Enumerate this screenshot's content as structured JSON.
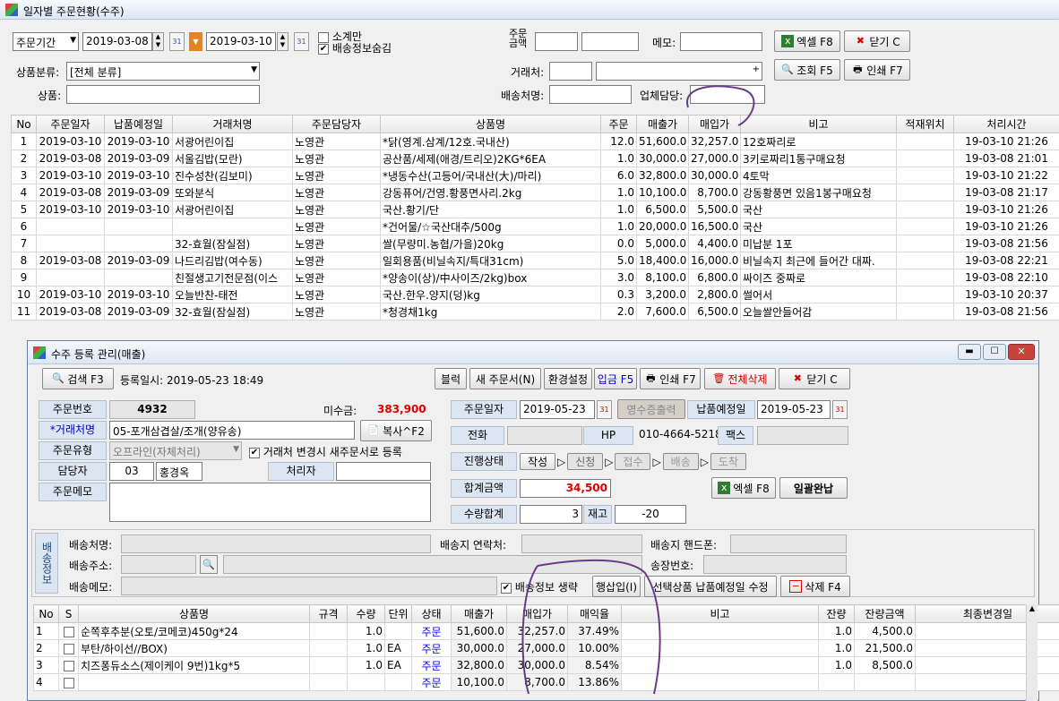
{
  "main": {
    "title": "일자별 주문현황(수주)",
    "period_select": "주문기간",
    "date_from": "2019-03-08",
    "date_to": "2019-03-10",
    "chk_subtotal": "소계만",
    "chk_hide_delivery": "배송정보숨김",
    "order_amount_label": "주문\n금액",
    "memo_label": "메모:",
    "excel_btn": "엑셀 F8",
    "close_btn": "닫기 C",
    "category_label": "상품분류:",
    "category_value": "[전체 분류]",
    "client_label": "거래처:",
    "search_btn": "조회 F5",
    "print_btn": "인쇄 F7",
    "product_label": "상품:",
    "recipient_label": "배송처명:",
    "manager_label": "업체담당:",
    "columns": [
      "No",
      "주문일자",
      "납품예정일",
      "거래처명",
      "주문담당자",
      "상품명",
      "주문",
      "매출가",
      "매입가",
      "비고",
      "적재위치",
      "처리시간"
    ],
    "rows": [
      [
        "1",
        "2019-03-10",
        "2019-03-10",
        "서광어린이집",
        "노영관",
        "*닭(영계.삼계/12호.국내산)",
        "12.0",
        "51,600.0",
        "32,257.0",
        "12호짜리로",
        "",
        "19-03-10 21:26"
      ],
      [
        "2",
        "2019-03-08",
        "2019-03-09",
        "서울김밥(모란)",
        "노영관",
        "공산품/세제(애경/트리오)2KG*6EA",
        "1.0",
        "30,000.0",
        "27,000.0",
        "3키로짜리1통구매요청",
        "",
        "19-03-08 21:01"
      ],
      [
        "3",
        "2019-03-10",
        "2019-03-10",
        "진수성찬(김보미)",
        "노영관",
        "*냉동수산(고등어/국내산(大)/마리)",
        "6.0",
        "32,800.0",
        "30,000.0",
        "4토막",
        "",
        "19-03-10 21:22"
      ],
      [
        "4",
        "2019-03-08",
        "2019-03-09",
        "또와분식",
        "노영관",
        "강동퓨어/건영.황풍면사리.2kg",
        "1.0",
        "10,100.0",
        "8,700.0",
        "강동황풍면 있음1봉구매요청",
        "",
        "19-03-08 21:17"
      ],
      [
        "5",
        "2019-03-10",
        "2019-03-10",
        "서광어린이집",
        "노영관",
        "국산.황기/단",
        "1.0",
        "6,500.0",
        "5,500.0",
        "국산",
        "",
        "19-03-10 21:26"
      ],
      [
        "6",
        "",
        "",
        "",
        "노영관",
        "*건어물/☆국산대추/500g",
        "1.0",
        "20,000.0",
        "16,500.0",
        "국산",
        "",
        "19-03-10 21:26"
      ],
      [
        "7",
        "",
        "",
        "32-효월(잠실점)",
        "노영관",
        "쌀(무량미.농협/가을)20kg",
        "0.0",
        "5,000.0",
        "4,400.0",
        "미납분 1포",
        "",
        "19-03-08 21:56"
      ],
      [
        "8",
        "2019-03-08",
        "2019-03-09",
        "나드리김밥(여수동)",
        "노영관",
        "일회용품(비닐속지/특대31cm)",
        "5.0",
        "18,400.0",
        "16,000.0",
        "비닐속지 최근에 들어간 대짜.",
        "",
        "19-03-08 22:21"
      ],
      [
        "9",
        "",
        "",
        "친절생고기전문점(이스",
        "노영관",
        "*양송이(상)/中사이즈/2kg)box",
        "3.0",
        "8,100.0",
        "6,800.0",
        "싸이즈 중짜로",
        "",
        "19-03-08 22:10"
      ],
      [
        "10",
        "2019-03-10",
        "2019-03-10",
        "오늘반찬-태전",
        "노영관",
        "국산.한우.양지(덩)kg",
        "0.3",
        "3,200.0",
        "2,800.0",
        "썰어서",
        "",
        "19-03-10 20:37"
      ],
      [
        "11",
        "2019-03-08",
        "2019-03-09",
        "32-효월(잠실점)",
        "노영관",
        "*청경채1kg",
        "2.0",
        "7,600.0",
        "6,500.0",
        "오늘쌀안들어감",
        "",
        "19-03-08 21:56"
      ]
    ]
  },
  "dialog": {
    "title": "수주 등록 관리(매출)",
    "search_btn": "검색 F3",
    "reg_date": "등록일시: 2019-05-23 18:49",
    "toolbar": [
      "블럭",
      "새 주문서(N)",
      "환경설정",
      "입금 F5",
      "인쇄 F7",
      "전체삭제",
      "닫기 C"
    ],
    "order_no_label": "주문번호",
    "order_no": "4932",
    "unpaid_label": "미수금:",
    "unpaid": "383,900",
    "client_label": "*거래처명",
    "client": "05-포개삼겹살/조개(양유송)",
    "copy_btn": "복사^F2",
    "order_type_label": "주문유형",
    "order_type": "오프라인(자체처리)",
    "chk_new_order": "거래처 변경시 새주문서로 등록",
    "staff_label": "담당자",
    "staff_code": "03",
    "staff_name": "홍경옥",
    "handler_label": "처리자",
    "memo_label": "주문메모",
    "order_date_label": "주문일자",
    "order_date": "2019-05-23",
    "receipt_btn": "영수증출력",
    "delivery_date_label": "납품예정일",
    "delivery_date": "2019-05-23",
    "phone_label": "전화",
    "hp_label": "HP",
    "hp": "010-4664-5218",
    "fax_label": "팩스",
    "progress_label": "진행상태",
    "steps": [
      "작성",
      "신청",
      "접수",
      "배송",
      "도착"
    ],
    "total_label": "합계금액",
    "total": "34,500",
    "excel_btn": "엑셀 F8",
    "payall_btn": "일괄완납",
    "qty_label": "수량합계",
    "qty": "3",
    "stock_label": "재고",
    "stock": "-20",
    "ship_side": "배송정보",
    "ship_name_label": "배송처명:",
    "ship_contact_label": "배송지 연락처:",
    "ship_phone_label": "배송지 핸드폰:",
    "ship_addr_label": "배송주소:",
    "track_label": "송장번호:",
    "ship_memo_label": "배송메모:",
    "chk_skip_ship": "배송정보 생략",
    "insert_row_btn": "행삽입(I)",
    "set_delivery_btn": "선택상품 납품예정일 수정",
    "delete_btn": "삭제 F4",
    "columns": [
      "No",
      "S",
      "상품명",
      "규격",
      "수량",
      "단위",
      "상태",
      "매출가",
      "매입가",
      "매익율",
      "비고",
      "잔량",
      "잔량금액",
      "최종변경일"
    ],
    "rows": [
      [
        "1",
        "",
        "순쪽후추분(오토/코메코)450g*24",
        "",
        "1.0",
        "",
        "주문",
        "51,600.0",
        "32,257.0",
        "37.49%",
        "",
        "1.0",
        "4,500.0",
        ""
      ],
      [
        "2",
        "",
        "부탄/하이선//BOX)",
        "",
        "1.0",
        "EA",
        "주문",
        "30,000.0",
        "27,000.0",
        "10.00%",
        "",
        "1.0",
        "21,500.0",
        ""
      ],
      [
        "3",
        "",
        "치즈퐁듀소스(제이케이 9번)1kg*5",
        "",
        "1.0",
        "EA",
        "주문",
        "32,800.0",
        "30,000.0",
        "8.54%",
        "",
        "1.0",
        "8,500.0",
        ""
      ],
      [
        "4",
        "",
        "",
        "",
        "",
        "",
        "주문",
        "10,100.0",
        "8,700.0",
        "13.86%",
        "",
        "",
        "",
        ""
      ]
    ]
  }
}
